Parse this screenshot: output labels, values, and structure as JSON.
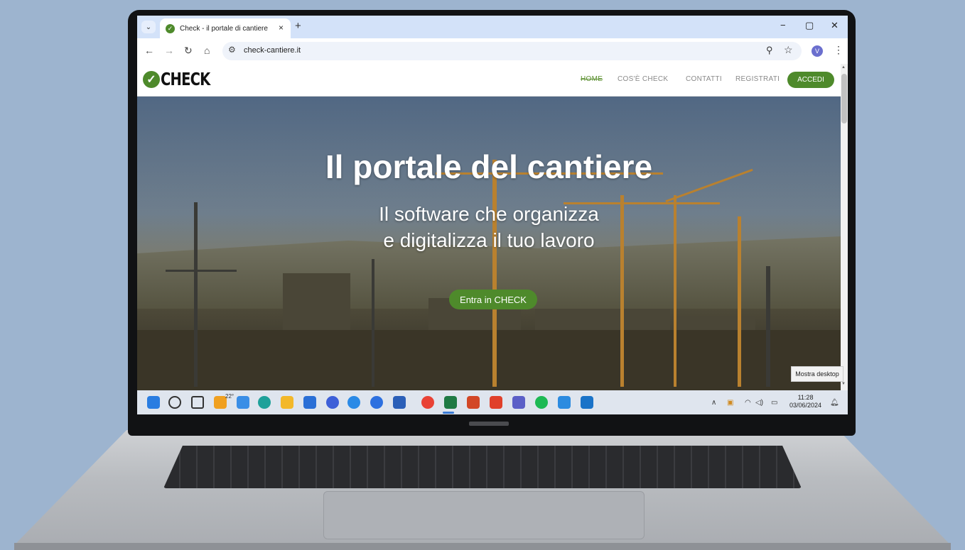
{
  "browser": {
    "tab_title": "Check - il portale di cantiere",
    "tab_close": "×",
    "new_tab": "+",
    "url": "check-cantiere.it",
    "avatar_letter": "V",
    "controls": {
      "minimize": "−",
      "maximize": "▢",
      "close": "✕"
    },
    "icons": [
      "tab-search-icon",
      "back-icon",
      "forward-icon",
      "reload-icon",
      "home-icon",
      "site-info-icon",
      "zoom-icon",
      "star-icon",
      "menu-icon"
    ]
  },
  "site": {
    "logo_text": "CHECK",
    "nav": [
      {
        "label": "HOME",
        "active": true
      },
      {
        "label": "COS'È CHECK"
      },
      {
        "label": "CONTATTI"
      },
      {
        "label": "REGISTRATI"
      }
    ],
    "login_label": "ACCEDI",
    "hero": {
      "title": "Il portale del cantiere",
      "subtitle_line1": "Il software che organizza",
      "subtitle_line2": "e digitalizza il tuo lavoro",
      "cta_label": "Entra in CHECK"
    },
    "colors": {
      "brand_green": "#4e8a2b"
    }
  },
  "desktop": {
    "tooltip": "Mostra desktop",
    "weather_temp": "22°",
    "clock_time": "11:28",
    "clock_date": "03/06/2024",
    "taskbar_apps": [
      {
        "name": "start",
        "color": "#2a7de1"
      },
      {
        "name": "search",
        "color": "#333333"
      },
      {
        "name": "task-view",
        "color": "#333333"
      },
      {
        "name": "weather",
        "color": "#f0a020"
      },
      {
        "name": "onedrive",
        "color": "#3a8ee6"
      },
      {
        "name": "edge",
        "color": "#1fa19a"
      },
      {
        "name": "file-explorer",
        "color": "#f3b829"
      },
      {
        "name": "store",
        "color": "#2a6fd6"
      },
      {
        "name": "app-c",
        "color": "#3d5fd8"
      },
      {
        "name": "app-s",
        "color": "#2a8ae6"
      },
      {
        "name": "zoom",
        "color": "#2d70e0"
      },
      {
        "name": "word",
        "color": "#2b5fb8"
      },
      {
        "name": "chrome",
        "color": "#e94235"
      },
      {
        "name": "excel",
        "color": "#1f7a44"
      },
      {
        "name": "powerpoint",
        "color": "#d24726"
      },
      {
        "name": "app-red",
        "color": "#e0402a"
      },
      {
        "name": "teams",
        "color": "#5b5fc7"
      },
      {
        "name": "spotify",
        "color": "#1db954"
      },
      {
        "name": "app-blue",
        "color": "#2c8be0"
      },
      {
        "name": "outlook",
        "color": "#1a73c8"
      }
    ]
  }
}
